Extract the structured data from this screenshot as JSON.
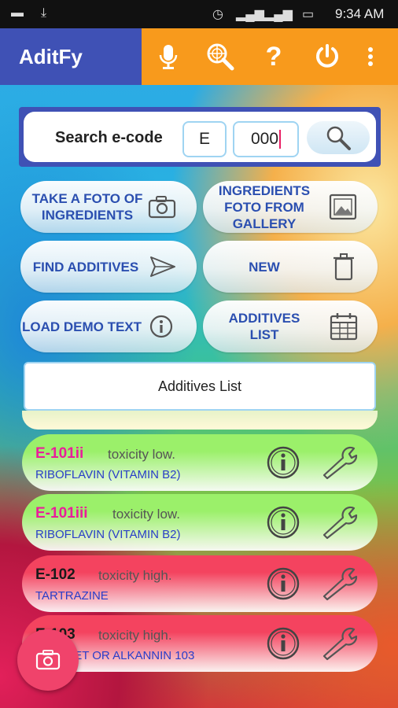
{
  "status_bar": {
    "time": "9:34 AM"
  },
  "app_bar": {
    "title": "AditFy"
  },
  "search": {
    "label": "Search e-code",
    "prefix_value": "E",
    "code_value": "000"
  },
  "buttons": {
    "take_foto": "TAKE A FOTO OF\nINGREDIENTS",
    "gallery": "INGREDIENTS\nFOTO FROM\nGALLERY",
    "find_additives": "FIND ADDITIVES",
    "new": "NEW",
    "load_demo": "LOAD DEMO TEXT",
    "additives_list": "ADDITIVES\nLIST"
  },
  "list_header": "Additives List",
  "additives": [
    {
      "code": "E-101ii",
      "toxicity": "toxicity low.",
      "name": "RIBOFLAVIN (VITAMIN B2)",
      "code_color": "#e91e9b",
      "bg": "#9bf06a"
    },
    {
      "code": "E-101iii",
      "toxicity": "toxicity low.",
      "name": "RIBOFLAVIN (VITAMIN B2)",
      "code_color": "#e91e9b",
      "bg": "#9bf06a"
    },
    {
      "code": "E-102",
      "toxicity": "toxicity high.",
      "name": "TARTRAZINE",
      "code_color": "#1a1a1a",
      "bg": "#f4435f"
    },
    {
      "code": "E-103",
      "toxicity": "toxicity high.",
      "name": "ALKANET OR ALKANNIN 103",
      "code_color": "#1a1a1a",
      "bg": "#f4435f"
    }
  ],
  "colors": {
    "primary": "#3f51b5",
    "accent": "#f89a1c",
    "fab": "#f0436b",
    "label_blue": "#2b4fb0"
  }
}
